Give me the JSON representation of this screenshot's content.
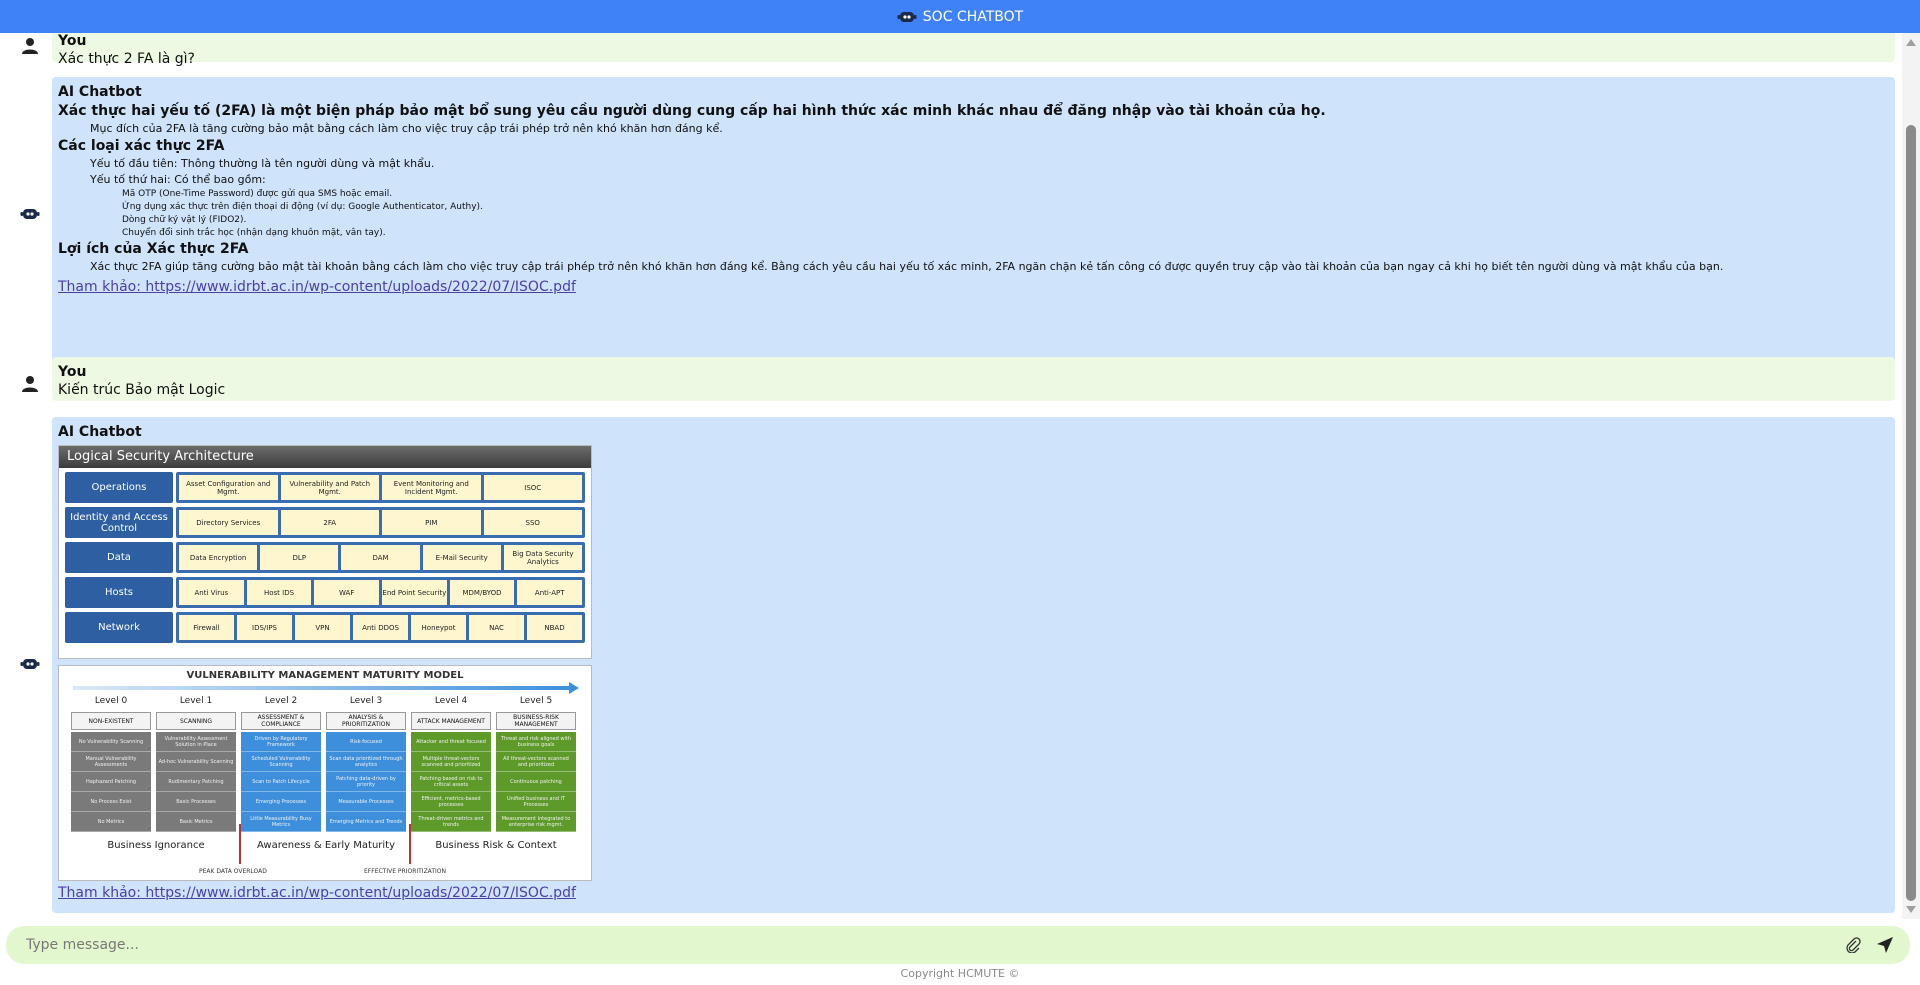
{
  "app": {
    "title": "SOC CHATBOT",
    "footer": "Copyright HCMUTE ©"
  },
  "input": {
    "placeholder": "Type message...",
    "value": ""
  },
  "messages": {
    "m1": {
      "sender": "You",
      "text": "Xác thực 2 FA là gì?"
    },
    "m2": {
      "sender": "AI Chatbot",
      "h1": "Xác thực hai yếu tố (2FA) là một biện pháp bảo mật bổ sung yêu cầu người dùng cung cấp hai hình thức xác minh khác nhau để đăng nhập vào tài khoản của họ.",
      "p1": "Mục đích của 2FA là tăng cường bảo mật bằng cách làm cho việc truy cập trái phép trở nên khó khăn hơn đáng kể.",
      "h2": "Các loại xác thực 2FA",
      "p2": "Yếu tố đầu tiên: Thông thường là tên người dùng và mật khẩu.",
      "p3": "Yếu tố thứ hai: Có thể bao gồm:",
      "s1": "Mã OTP (One-Time Password) được gửi qua SMS hoặc email.",
      "s2": "Ứng dụng xác thực trên điện thoại di động (ví dụ: Google Authenticator, Authy).",
      "s3": "Dòng chữ ký vật lý (FIDO2).",
      "s4": "Chuyển đổi sinh trắc học (nhận dạng khuôn mặt, vân tay).",
      "h3": "Lợi ích của Xác thực 2FA",
      "p4": "Xác thực 2FA giúp tăng cường bảo mật tài khoản bằng cách làm cho việc truy cập trái phép trở nên khó khăn hơn đáng kể. Bằng cách yêu cầu hai yếu tố xác minh, 2FA ngăn chặn kẻ tấn công có được quyền truy cập vào tài khoản của bạn ngay cả khi họ biết tên người dùng và mật khẩu của bạn.",
      "ref": "Tham khảo: https://www.idrbt.ac.in/wp-content/uploads/2022/07/ISOC.pdf"
    },
    "m3": {
      "sender": "You",
      "text": "Kiến trúc Bảo mật Logic"
    },
    "m4": {
      "sender": "AI Chatbot",
      "ref": "Tham khảo: https://www.idrbt.ac.in/wp-content/uploads/2022/07/ISOC.pdf"
    }
  },
  "lsa": {
    "title": "Logical Security Architecture",
    "rows": [
      {
        "label": "Operations",
        "cells": [
          "Asset Configuration and Mgmt.",
          "Vulnerability and Patch Mgmt.",
          "Event Monitoring and Incident Mgmt.",
          "ISOC"
        ]
      },
      {
        "label": "Identity and Access Control",
        "cells": [
          "Directory Services",
          "2FA",
          "PIM",
          "SSO"
        ]
      },
      {
        "label": "Data",
        "cells": [
          "Data Encryption",
          "DLP",
          "DAM",
          "E-Mail Security",
          "Big Data Security Analytics"
        ]
      },
      {
        "label": "Hosts",
        "cells": [
          "Anti Virus",
          "Host IDS",
          "WAF",
          "End Point Security",
          "MDM/BYOD",
          "Anti-APT"
        ]
      },
      {
        "label": "Network",
        "cells": [
          "Firewall",
          "IDS/IPS",
          "VPN",
          "Anti DDOS",
          "Honeypot",
          "NAC",
          "NBAD"
        ]
      }
    ]
  },
  "vmm": {
    "title": "VULNERABILITY MANAGEMENT MATURITY MODEL",
    "levels": [
      {
        "level": "Level 0",
        "name": "NON-EXISTENT",
        "color": "#7a7a7a",
        "items": [
          "No Vulnerability Scanning",
          "Manual Vulnerability Assessments",
          "Haphazard Patching",
          "No Process Exist",
          "No Metrics"
        ]
      },
      {
        "level": "Level 1",
        "name": "SCANNING",
        "color": "#7a7a7a",
        "items": [
          "Vulnerability Assessment Solution in Place",
          "Ad-hoc Vulnerability Scanning",
          "Rudimentary Patching",
          "Basic Processes",
          "Basic Metrics"
        ]
      },
      {
        "level": "Level 2",
        "name": "ASSESSMENT & COMPLIANCE",
        "color": "#3d8fdc",
        "items": [
          "Driven by Regulatory Framework",
          "Scheduled Vulnerability Scanning",
          "Scan to Patch Lifecycle",
          "Emerging Processes",
          "Little Measurability Busy Metrics"
        ]
      },
      {
        "level": "Level 3",
        "name": "ANALYSIS & PRIORITIZATION",
        "color": "#3d8fdc",
        "items": [
          "Risk-focused",
          "Scan data prioritized through analytics",
          "Patching data-driven by priority",
          "Measurable Processes",
          "Emerging Metrics and Trends"
        ]
      },
      {
        "level": "Level 4",
        "name": "ATTACK MANAGEMENT",
        "color": "#5e9a2a",
        "items": [
          "Attacker and threat focused",
          "Multiple threat-vectors scanned and prioritized",
          "Patching based on risk to critical assets",
          "Efficient, metrics-based processes",
          "Threat-driven metrics and trends"
        ]
      },
      {
        "level": "Level 5",
        "name": "BUSINESS-RISK MANAGEMENT",
        "color": "#5e9a2a",
        "items": [
          "Threat and risk aligned with business goals",
          "All threat-vectors scanned and prioritized",
          "Continuous patching",
          "Unified business and IT Processes",
          "Measurement integrated to enterprise risk mgmt."
        ]
      }
    ],
    "stages": [
      "Business Ignorance",
      "Awareness & Early Maturity",
      "Business Risk & Context"
    ],
    "markers": [
      "PEAK DATA OVERLOAD",
      "EFFECTIVE PRIORITIZATION"
    ]
  }
}
